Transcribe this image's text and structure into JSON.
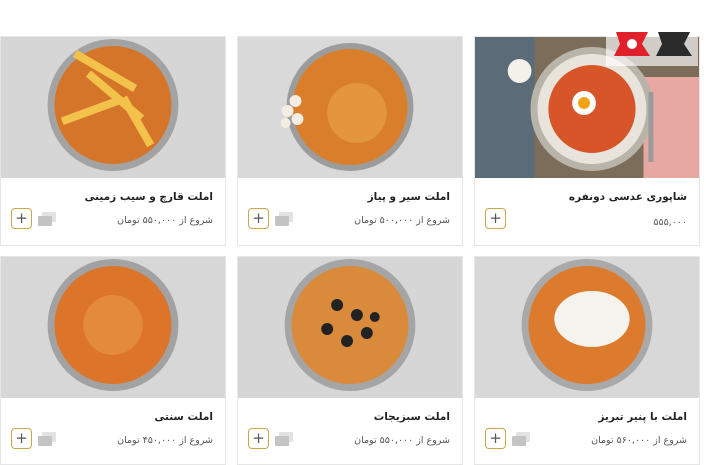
{
  "cards": [
    {
      "title": "شاپوری عدسی دونفره",
      "price": "۵۵۵,۰۰۰",
      "price_prefix": "",
      "add_label": "+"
    },
    {
      "title": "املت سیر و پیاز",
      "price": "شروع از ۵۰۰,۰۰۰ تومان",
      "add_label": "+"
    },
    {
      "title": "املت قارچ و سیب زمینی",
      "price": "شروع از ۵۵۰,۰۰۰ تومان",
      "add_label": "+"
    },
    {
      "title": "املت با پنیر تبریز",
      "price": "شروع از ۵۶۰,۰۰۰ تومان",
      "add_label": "+"
    },
    {
      "title": "املت سبزیجات",
      "price": "شروع از ۵۵۰,۰۰۰ تومان",
      "add_label": "+"
    },
    {
      "title": "املت سنتی",
      "price": "شروع از ۴۵۰,۰۰۰ تومان",
      "add_label": "+"
    }
  ],
  "logo": {
    "text": "رکنا"
  },
  "colors": {
    "accent": "#c9a84a",
    "logo_red": "#e0202a",
    "omelette": "#e07a2a",
    "pan": "#c9c9c9"
  }
}
